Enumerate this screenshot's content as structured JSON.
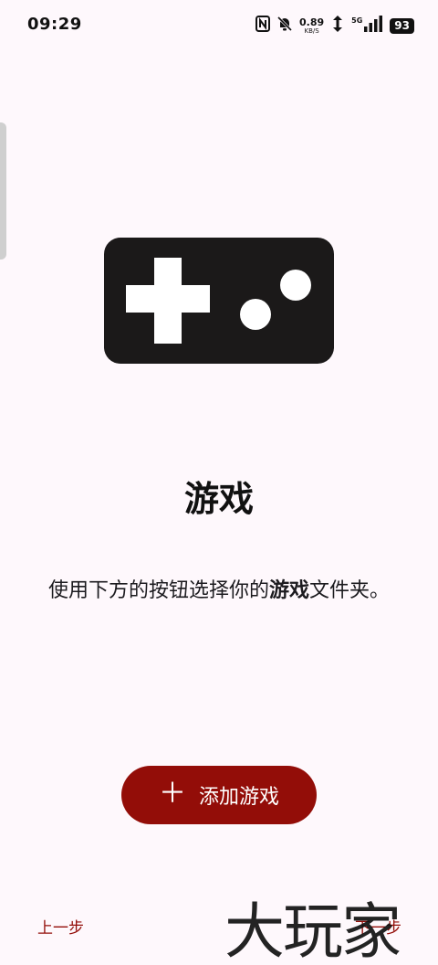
{
  "status_bar": {
    "time": "09:29",
    "net_speed_value": "0.89",
    "net_speed_unit": "KB/S",
    "signal_label": "5G",
    "battery": "93",
    "icons": [
      "nfc-icon",
      "bell-muted-icon",
      "wifi-icon",
      "signal-icon"
    ]
  },
  "illustration": {
    "icon": "gamepad-icon",
    "color": "#1b1919"
  },
  "main": {
    "title": "游戏",
    "description_before": "使用下方的按钮选择你的",
    "description_bold": "游戏",
    "description_after": "文件夹。"
  },
  "actions": {
    "add_button_label": "添加游戏",
    "add_button_icon": "plus-icon",
    "prev_label": "上一步",
    "next_label": "下一步"
  },
  "watermark": {
    "text": "大玩家"
  },
  "colors": {
    "accent": "#930d08",
    "background": "#fef8fc",
    "text": "#1c1b1f"
  }
}
